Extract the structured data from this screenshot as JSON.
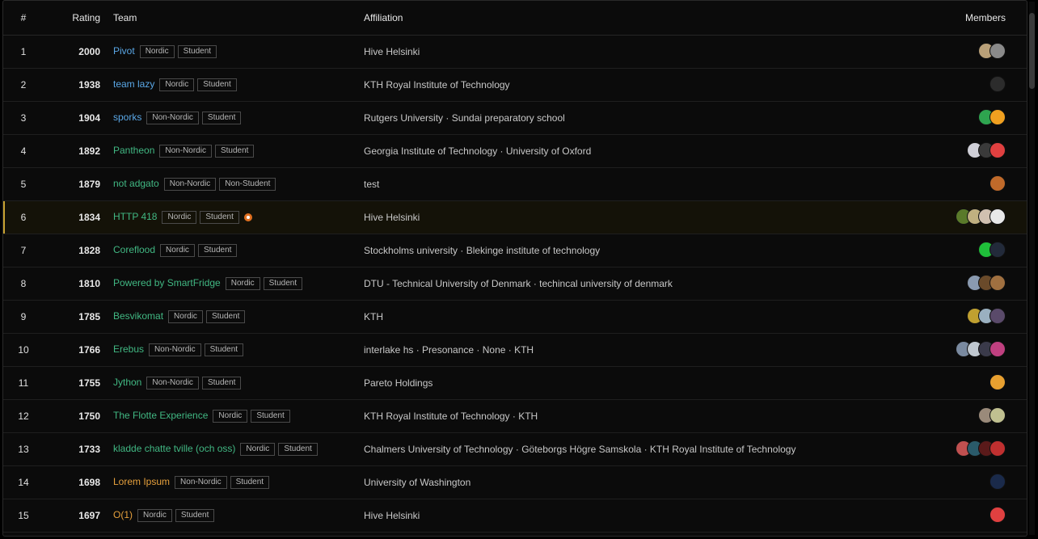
{
  "headers": {
    "rank": "#",
    "rating": "Rating",
    "team": "Team",
    "affiliation": "Affiliation",
    "members": "Members"
  },
  "colors": {
    "blue": "#5aa7e6",
    "green": "#41b883",
    "orange": "#e6a03c",
    "highlight_border": "#c8a230",
    "flame": "#e07020"
  },
  "rows": [
    {
      "rank": "1",
      "rating": "2000",
      "team": "Pivot",
      "color": "blue",
      "tags": [
        "Nordic",
        "Student"
      ],
      "flame": false,
      "affiliation": "Hive Helsinki",
      "members": [
        "#b9a078",
        "#8a8a8a"
      ]
    },
    {
      "rank": "2",
      "rating": "1938",
      "team": "team lazy",
      "color": "blue",
      "tags": [
        "Nordic",
        "Student"
      ],
      "flame": false,
      "affiliation": "KTH Royal Institute of Technology",
      "members": [
        "#2c2c2c"
      ]
    },
    {
      "rank": "3",
      "rating": "1904",
      "team": "sporks",
      "color": "blue",
      "tags": [
        "Non-Nordic",
        "Student"
      ],
      "flame": false,
      "affiliation": "Rutgers University · Sundai preparatory school",
      "members": [
        "#2ea44f",
        "#f0a020"
      ]
    },
    {
      "rank": "4",
      "rating": "1892",
      "team": "Pantheon",
      "color": "green",
      "tags": [
        "Non-Nordic",
        "Student"
      ],
      "flame": false,
      "affiliation": "Georgia Institute of Technology · University of Oxford",
      "members": [
        "#d0d0d8",
        "#3a3a3a",
        "#e04040"
      ]
    },
    {
      "rank": "5",
      "rating": "1879",
      "team": "not adgato",
      "color": "green",
      "tags": [
        "Non-Nordic",
        "Non-Student"
      ],
      "flame": false,
      "affiliation": "test",
      "members": [
        "#c06a2a"
      ]
    },
    {
      "rank": "6",
      "rating": "1834",
      "team": "HTTP 418",
      "color": "green",
      "tags": [
        "Nordic",
        "Student"
      ],
      "flame": true,
      "affiliation": "Hive Helsinki",
      "members": [
        "#5a7a2a",
        "#c0b080",
        "#d0c0b0",
        "#e8e8e8"
      ]
    },
    {
      "rank": "7",
      "rating": "1828",
      "team": "Coreflood",
      "color": "green",
      "tags": [
        "Nordic",
        "Student"
      ],
      "flame": false,
      "affiliation": "Stockholms university · Blekinge institute of technology",
      "members": [
        "#1fbf3a",
        "#222a3a"
      ]
    },
    {
      "rank": "8",
      "rating": "1810",
      "team": "Powered by SmartFridge",
      "color": "green",
      "tags": [
        "Nordic",
        "Student"
      ],
      "flame": false,
      "affiliation": "DTU - Technical University of Denmark · techincal university of denmark",
      "members": [
        "#8a9ab0",
        "#6a4a2a",
        "#a07040"
      ]
    },
    {
      "rank": "9",
      "rating": "1785",
      "team": "Besvikomat",
      "color": "green",
      "tags": [
        "Nordic",
        "Student"
      ],
      "flame": false,
      "affiliation": "KTH",
      "members": [
        "#c0a030",
        "#9ab0c0",
        "#5a4a6a"
      ]
    },
    {
      "rank": "10",
      "rating": "1766",
      "team": "Erebus",
      "color": "green",
      "tags": [
        "Non-Nordic",
        "Student"
      ],
      "flame": false,
      "affiliation": "interlake hs · Presonance · None · KTH",
      "members": [
        "#7a8aa0",
        "#c0c8d0",
        "#3a3a4a",
        "#c04080"
      ]
    },
    {
      "rank": "11",
      "rating": "1755",
      "team": "Jython",
      "color": "green",
      "tags": [
        "Non-Nordic",
        "Student"
      ],
      "flame": false,
      "affiliation": "Pareto Holdings",
      "members": [
        "#e8a030"
      ]
    },
    {
      "rank": "12",
      "rating": "1750",
      "team": "The Flotte Experience",
      "color": "green",
      "tags": [
        "Nordic",
        "Student"
      ],
      "flame": false,
      "affiliation": "KTH Royal Institute of Technology · KTH",
      "members": [
        "#9a8a7a",
        "#c0c090"
      ]
    },
    {
      "rank": "13",
      "rating": "1733",
      "team": "kladde chatte tville (och oss)",
      "color": "green",
      "tags": [
        "Nordic",
        "Student"
      ],
      "flame": false,
      "affiliation": "Chalmers University of Technology · Göteborgs Högre Samskola · KTH Royal Institute of Technology",
      "members": [
        "#c05050",
        "#2a5a6a",
        "#5a1a1a",
        "#c03030"
      ]
    },
    {
      "rank": "14",
      "rating": "1698",
      "team": "Lorem Ipsum",
      "color": "orange",
      "tags": [
        "Non-Nordic",
        "Student"
      ],
      "flame": false,
      "affiliation": "University of Washington",
      "members": [
        "#1a2a4a"
      ]
    },
    {
      "rank": "15",
      "rating": "1697",
      "team": "O(1)",
      "color": "orange",
      "tags": [
        "Nordic",
        "Student"
      ],
      "flame": false,
      "affiliation": "Hive Helsinki",
      "members": [
        "#e04040"
      ]
    }
  ]
}
